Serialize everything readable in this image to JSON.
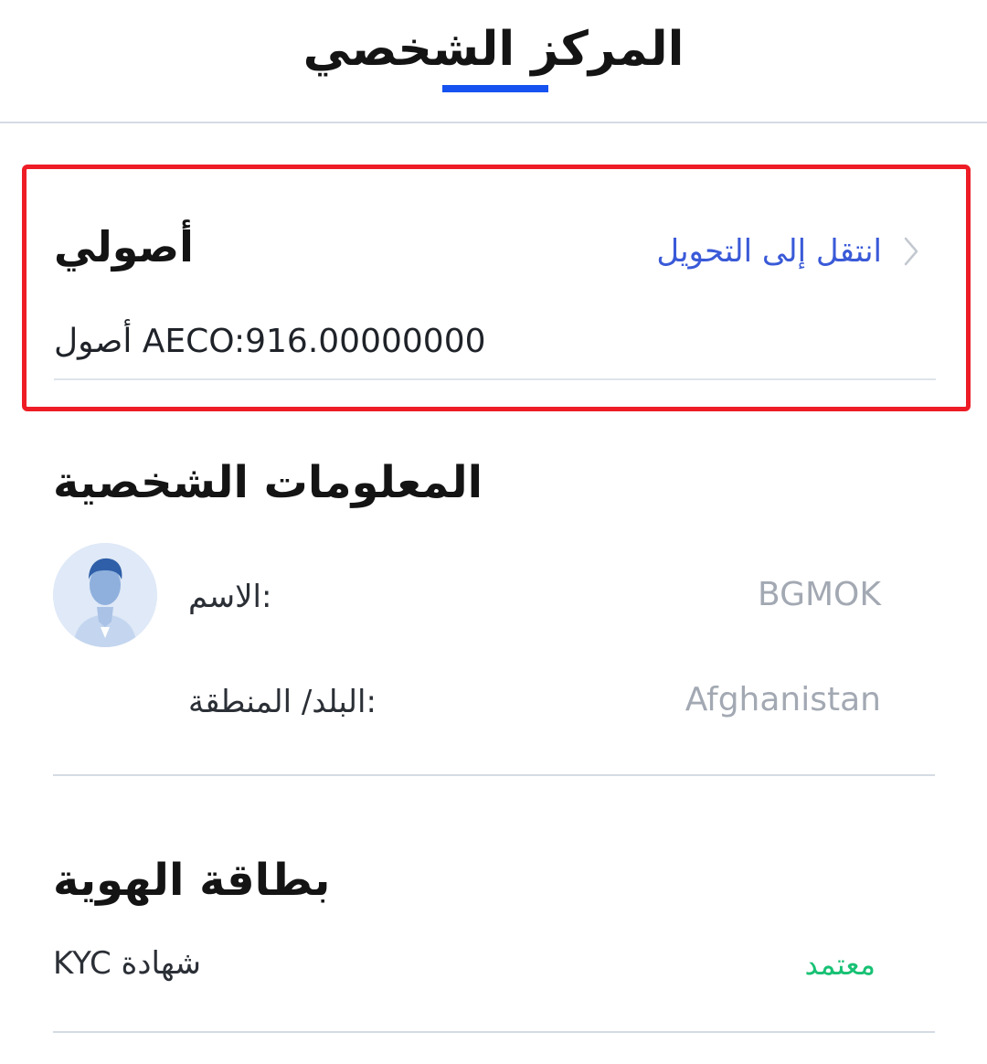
{
  "header": {
    "tab_label": "المركز الشخصي"
  },
  "assets": {
    "title": "أصولي",
    "transfer_label": "انتقل إلى التحويل",
    "amount": "AECO:916.00000000",
    "amount_suffix": "أصول",
    "highlight_color": "#ee1c25"
  },
  "personal_info": {
    "title": "المعلومات الشخصية",
    "avatar_icon": "user-avatar-icon",
    "name_label": ":الاسم",
    "name_value": "BGMOK",
    "country_label": ":البلد/ المنطقة",
    "country_value": "Afghanistan"
  },
  "id_card": {
    "title": "بطاقة الهوية",
    "kyc_label": "KYC شهادة",
    "kyc_status": "معتمد",
    "status_color": "#18c174"
  },
  "colors": {
    "accent": "#1652f0",
    "link": "#3a5ad8"
  }
}
